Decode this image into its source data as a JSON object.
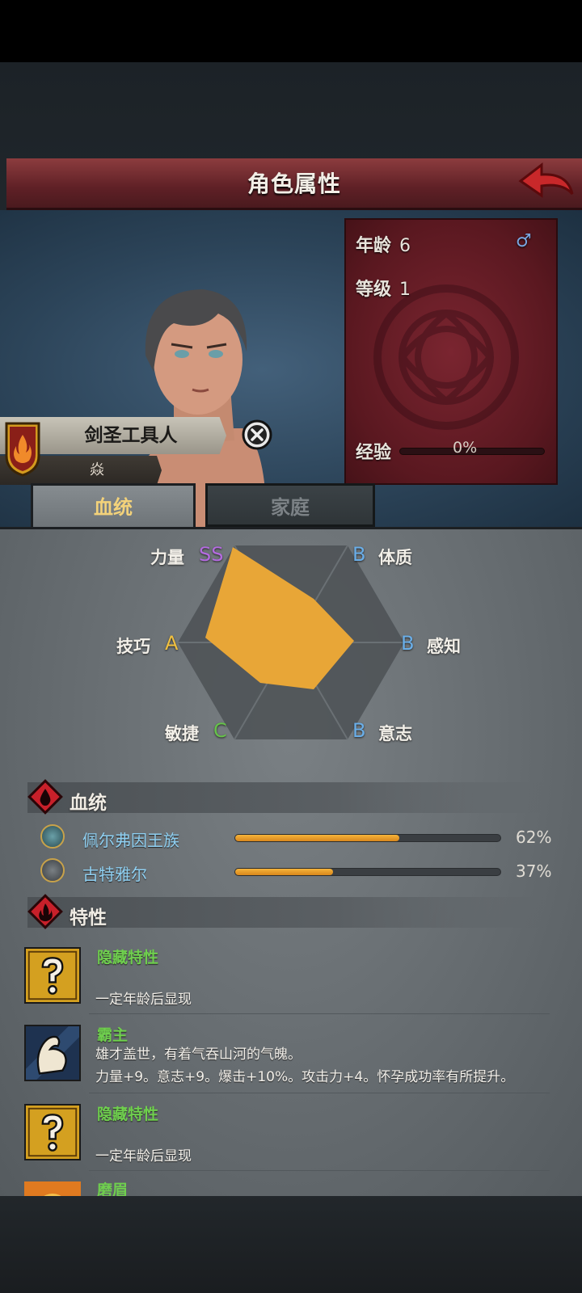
{
  "header": {
    "title": "角色属性"
  },
  "character": {
    "name": "剑圣工具人",
    "subtitle": "焱"
  },
  "info": {
    "age_label": "年龄",
    "age_value": "6",
    "gender_symbol": "♂",
    "level_label": "等级",
    "level_value": "1",
    "exp_label": "经验",
    "exp_value": "0%",
    "exp_progress": 0
  },
  "tabs": [
    {
      "label": "血统",
      "active": true
    },
    {
      "label": "家庭",
      "active": false
    }
  ],
  "stats": {
    "strength": {
      "name": "力量",
      "grade": "SS"
    },
    "constitution": {
      "name": "体质",
      "grade": "B"
    },
    "skill": {
      "name": "技巧",
      "grade": "A"
    },
    "perception": {
      "name": "感知",
      "grade": "B"
    },
    "agility": {
      "name": "敏捷",
      "grade": "C"
    },
    "will": {
      "name": "意志",
      "grade": "B"
    }
  },
  "bloodline": {
    "title": "血统",
    "items": [
      {
        "name": "佩尔弗因王族",
        "percent": "62%",
        "value": 0.62
      },
      {
        "name": "古特雅尔",
        "percent": "37%",
        "value": 0.37
      }
    ]
  },
  "traits": {
    "title": "特性",
    "items": [
      {
        "name": "隐藏特性",
        "line1": "",
        "line2": "一定年龄后显现",
        "icon": "question-icon"
      },
      {
        "name": "霸主",
        "line1": "雄才盖世，有着气吞山河的气魄。",
        "line2": "力量+9。意志+9。爆击+10%。攻击力+4。怀孕成功率有所提升。",
        "icon": "arm-icon"
      },
      {
        "name": "隐藏特性",
        "line1": "",
        "line2": "一定年龄后显现",
        "icon": "question-icon"
      },
      {
        "name": "磨眉",
        "line1": "",
        "line2": "",
        "icon": "sun-icon"
      }
    ]
  },
  "colors": {
    "grade_ss": "#b46be0",
    "grade_a": "#f0c040",
    "grade_b": "#6aaee8",
    "grade_c": "#66c24a",
    "trait_name": "#6fcf4e",
    "bloodline_name": "#8fd0f2"
  }
}
